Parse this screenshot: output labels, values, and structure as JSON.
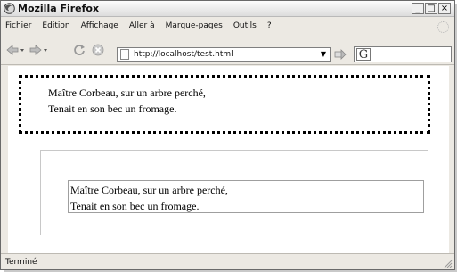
{
  "window": {
    "title": "Mozilla Firefox",
    "controls": {
      "minimize": "_",
      "maximize": "□",
      "close": "×"
    }
  },
  "menu": {
    "items": [
      {
        "label": "Fichier"
      },
      {
        "label": "Edition"
      },
      {
        "label": "Affichage"
      },
      {
        "label": "Aller à"
      },
      {
        "label": "Marque-pages"
      },
      {
        "label": "Outils"
      },
      {
        "label": "?"
      }
    ]
  },
  "navbar": {
    "back_icon": "back-arrow-icon",
    "forward_icon": "forward-arrow-icon",
    "reload_icon": "reload-icon",
    "stop_icon": "stop-icon",
    "home_icon": "home-icon",
    "url": "http://localhost/test.html",
    "dropdown_icon": "▼",
    "search_engine_glyph": "G"
  },
  "content": {
    "box1": {
      "lines": [
        "Maître Corbeau, sur un arbre perché,",
        "Tenait en son bec un fromage."
      ]
    },
    "box2": {
      "lines": [
        "Maître Corbeau, sur un arbre perché,",
        "Tenait en son bec un fromage."
      ]
    }
  },
  "status": {
    "text": "Terminé"
  },
  "colors": {
    "chrome": "#ece9e3",
    "dotted_border": "#000000",
    "outer_box_border": "#c8c8c8",
    "inner_box_border": "#9f9f9f"
  }
}
